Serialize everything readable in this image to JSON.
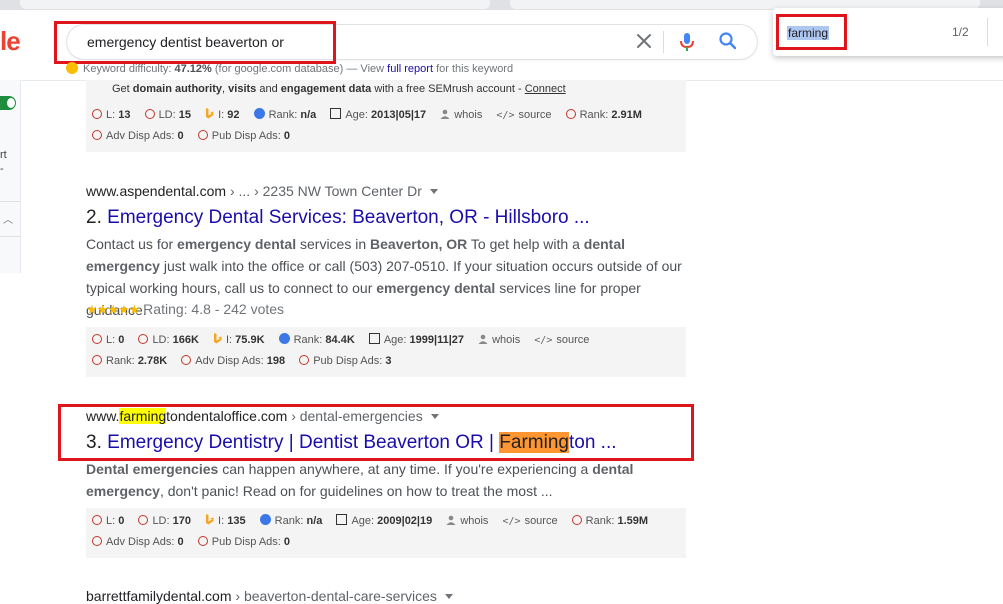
{
  "search": {
    "query": "emergency dentist beaverton or"
  },
  "logo_fragment": "le",
  "keyword_bar": {
    "label": "Keyword difficulty:",
    "value": "47.12%",
    "db_note": "(for google.com database)",
    "view_prefix": "— View",
    "link": "full report",
    "suffix": "for this keyword"
  },
  "find_bar": {
    "query": "farming",
    "count": "1/2"
  },
  "left_panel": {
    "letters": [
      "rt",
      "-"
    ]
  },
  "promo_line": {
    "prefix": "Get",
    "bold1": "domain authority",
    "sep1": ",",
    "bold2": "visits",
    "and": "and",
    "bold3": "engagement data",
    "mid": "with a free SEMrush account -",
    "link": "Connect"
  },
  "seo1": {
    "row1": {
      "l": "13",
      "ld": "15",
      "i": "92",
      "rank": "n/a",
      "age": "2013|05|17",
      "whois": "whois",
      "source": "source",
      "rank2": "2.91M"
    },
    "row2": {
      "adv": "0",
      "pub": "0"
    }
  },
  "result2": {
    "domain": "www.aspendental.com",
    "crumb": "› ... › 2235 NW Town Center Dr",
    "number": "2.",
    "title": "Emergency Dental Services: Beaverton, OR - Hillsboro ...",
    "snippet": {
      "p1": "Contact us for",
      "b1": "emergency dental",
      "p2": "services in",
      "b2": "Beaverton, OR",
      "p3": "To get help with a",
      "b3": "dental emergency",
      "p4": "just walk into the office or call (503) 207-0510. If your situation occurs outside of our typical working hours, call us to connect to our",
      "b4": "emergency dental",
      "p5": "services line for proper guidance."
    },
    "stars": "★★★★★",
    "rating": "Rating: 4.8 - 242 votes"
  },
  "seo2": {
    "row1": {
      "l": "0",
      "ld": "166K",
      "i": "75.9K",
      "rank": "84.4K",
      "age": "1999|11|27",
      "whois": "whois",
      "source": "source"
    },
    "row2": {
      "rank2": "2.78K",
      "adv": "198",
      "pub": "3"
    }
  },
  "result3": {
    "domain_prefix": "www.",
    "domain_highlight": "farming",
    "domain_suffix": "tondentaloffice.com",
    "crumb": "› dental-emergencies",
    "number": "3.",
    "title_prefix": "Emergency Dentistry | Dentist Beaverton OR |",
    "title_highlight": "Farming",
    "title_suffix": "ton ...",
    "snippet": {
      "b1": "Dental emergencies",
      "p1": "can happen anywhere, at any time. If you're experiencing a",
      "b2": "dental emergency",
      "p2": ", don't panic! Read on for guidelines on how to treat the most ..."
    }
  },
  "seo3": {
    "row1": {
      "l": "0",
      "ld": "170",
      "i": "135",
      "rank": "n/a",
      "age": "2009|02|19",
      "whois": "whois",
      "source": "source",
      "rank2": "1.59M"
    },
    "row2": {
      "adv": "0",
      "pub": "0"
    }
  },
  "result4": {
    "domain": "barrettfamilydental.com",
    "crumb": "› beaverton-dental-care-services"
  },
  "seo_labels": {
    "l": "L:",
    "ld": "LD:",
    "i": "I:",
    "rank": "Rank:",
    "age": "Age:",
    "adv": "Adv Disp Ads:",
    "pub": "Pub Disp Ads:"
  },
  "colors": {
    "annotation_red": "#e0151b",
    "link_blue": "#1a0dab",
    "highlight_yellow": "#ffff00",
    "highlight_orange": "#ff9632"
  }
}
